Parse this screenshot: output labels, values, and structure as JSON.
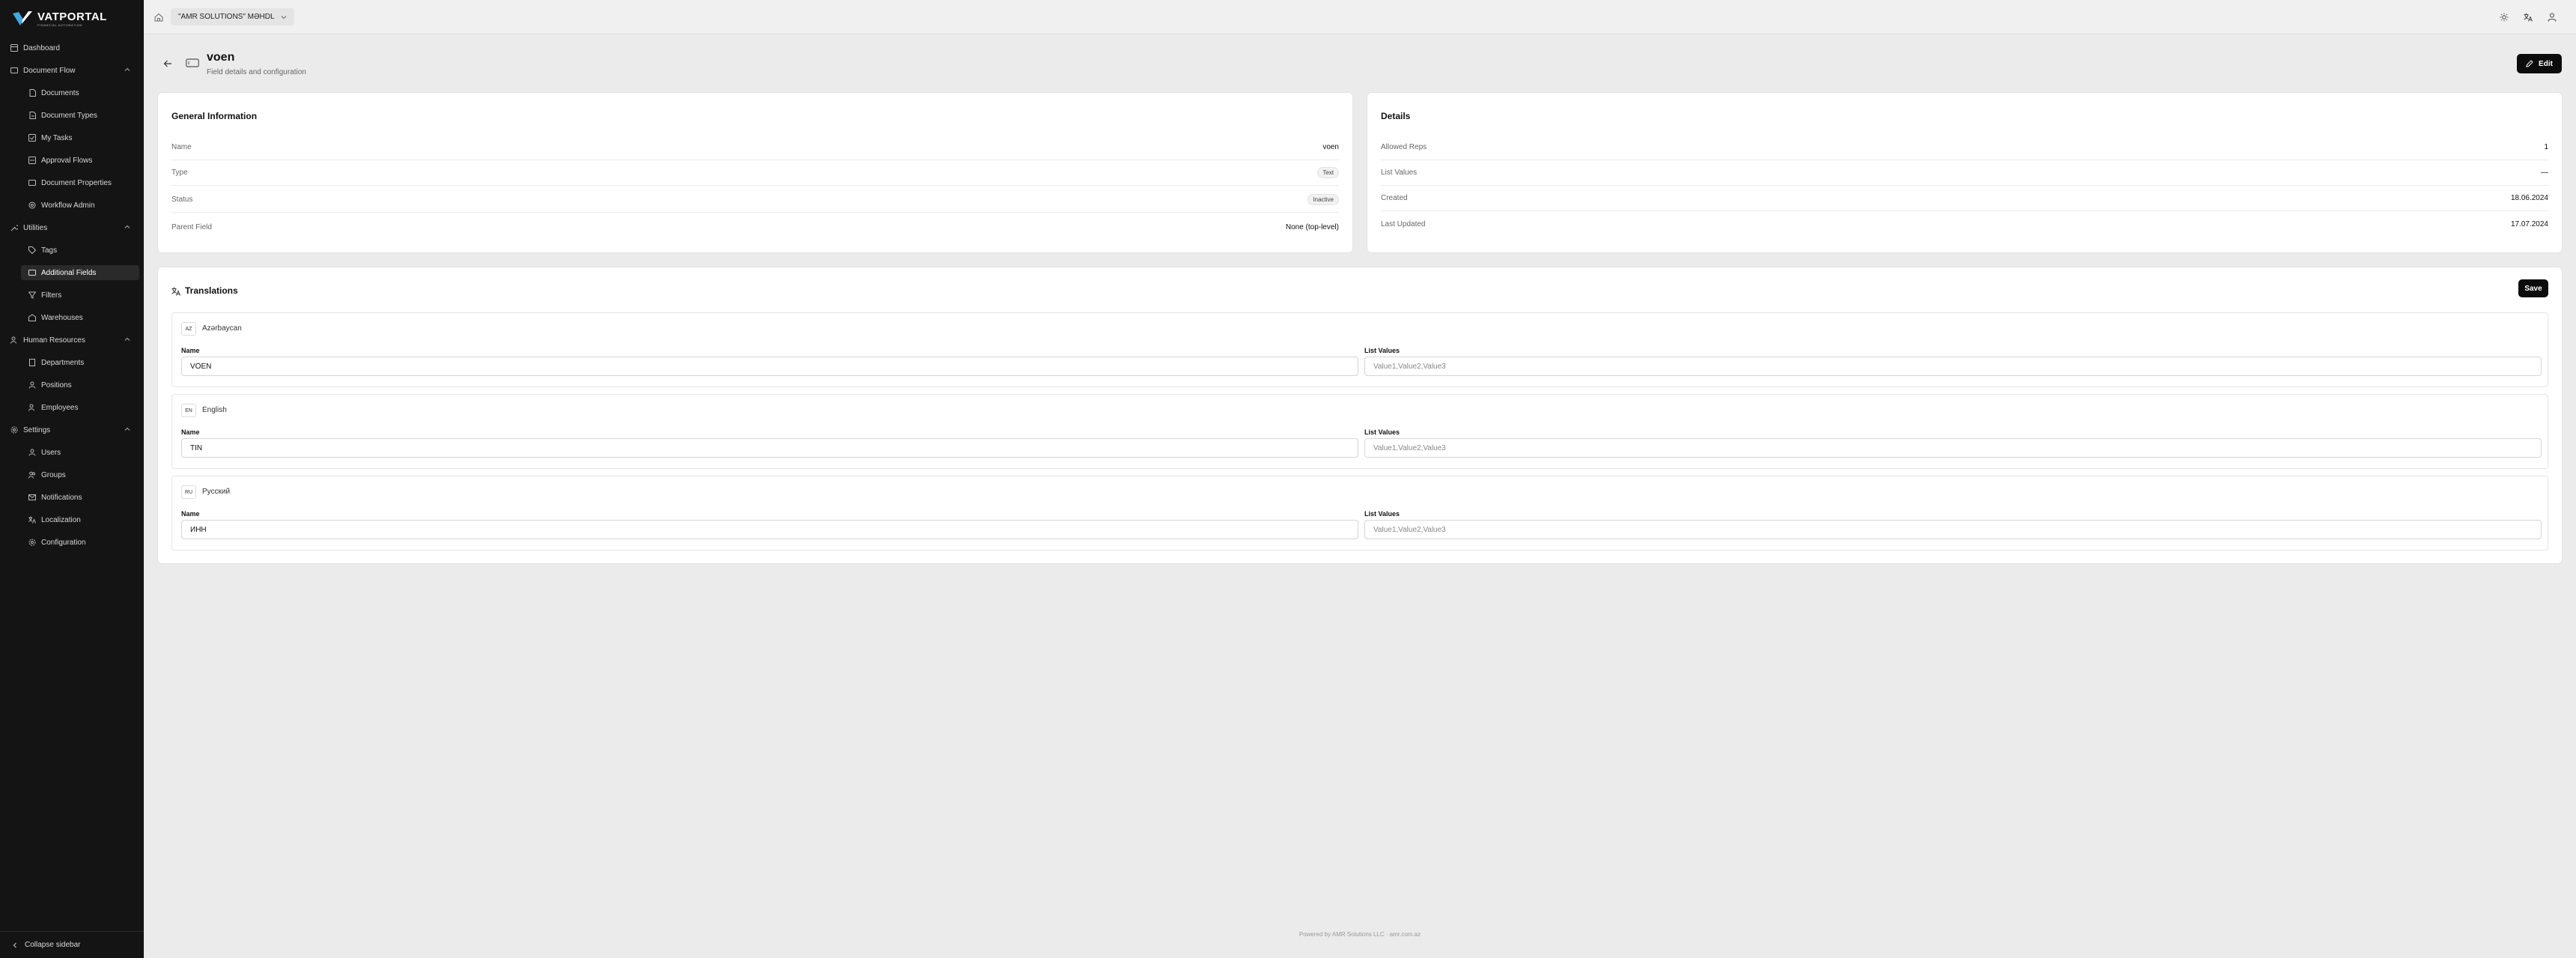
{
  "app": {
    "logo_title": "VATPORTAL",
    "logo_subtitle": "financial automation"
  },
  "sidebar": {
    "dashboard": "Dashboard",
    "document_flow": {
      "label": "Document Flow",
      "items": [
        "Documents",
        "Document Types",
        "My Tasks",
        "Approval Flows",
        "Document Properties",
        "Workflow Admin"
      ]
    },
    "utilities": {
      "label": "Utilities",
      "items": [
        "Tags",
        "Additional Fields",
        "Filters",
        "Warehouses"
      ],
      "active": "Additional Fields"
    },
    "human_resources": {
      "label": "Human Resources",
      "items": [
        "Departments",
        "Positions",
        "Employees"
      ]
    },
    "settings": {
      "label": "Settings",
      "items": [
        "Users",
        "Groups",
        "Notifications",
        "Localization",
        "Configuration"
      ]
    },
    "collapse_label": "Collapse sidebar"
  },
  "topbar": {
    "company": "\"AMR SOLUTIONS\" MƏHDL"
  },
  "header": {
    "title": "voen",
    "subtitle": "Field details and configuration",
    "edit_label": "Edit"
  },
  "general": {
    "title": "General Information",
    "rows": [
      {
        "label": "Name",
        "value": "voen"
      },
      {
        "label": "Type",
        "value": "Text"
      },
      {
        "label": "Status",
        "value": "Inactive"
      },
      {
        "label": "Parent Field",
        "value": "None (top-level)"
      }
    ]
  },
  "details": {
    "title": "Details",
    "rows": [
      {
        "label": "Allowed Reps",
        "value": "1"
      },
      {
        "label": "List Values",
        "value": "—"
      },
      {
        "label": "Created",
        "value": "18.06.2024"
      },
      {
        "label": "Last Updated",
        "value": "17.07.2024"
      }
    ]
  },
  "translations": {
    "title": "Translations",
    "save_label": "Save",
    "name_label": "Name",
    "list_values_label": "List Values",
    "languages": [
      {
        "code": "AZ",
        "name": "Azərbaycan",
        "name_value": "VÖEN",
        "list_placeholder": "Value1,Value2,Value3"
      },
      {
        "code": "EN",
        "name": "English",
        "name_value": "TIN",
        "list_placeholder": "Value1,Value2,Value3"
      },
      {
        "code": "RU",
        "name": "Русский",
        "name_value": "ИНН",
        "list_placeholder": "Value1,Value2,Value3"
      }
    ]
  },
  "footer": {
    "text": "Powered by AMR Solutions LLC · amr.com.az"
  },
  "colors": {
    "sidebar_bg": "#141414",
    "page_bg": "#ebebeb",
    "primary_button": "#0c0c0c",
    "logo_accent": "#3fa8e0"
  },
  "icons": [
    "logo-bird-icon",
    "home-icon",
    "chevron-down-icon",
    "sun-icon",
    "translate-icon",
    "user-icon",
    "arrow-left-icon",
    "field-box-icon",
    "pencil-icon",
    "chevron-left-icon"
  ]
}
